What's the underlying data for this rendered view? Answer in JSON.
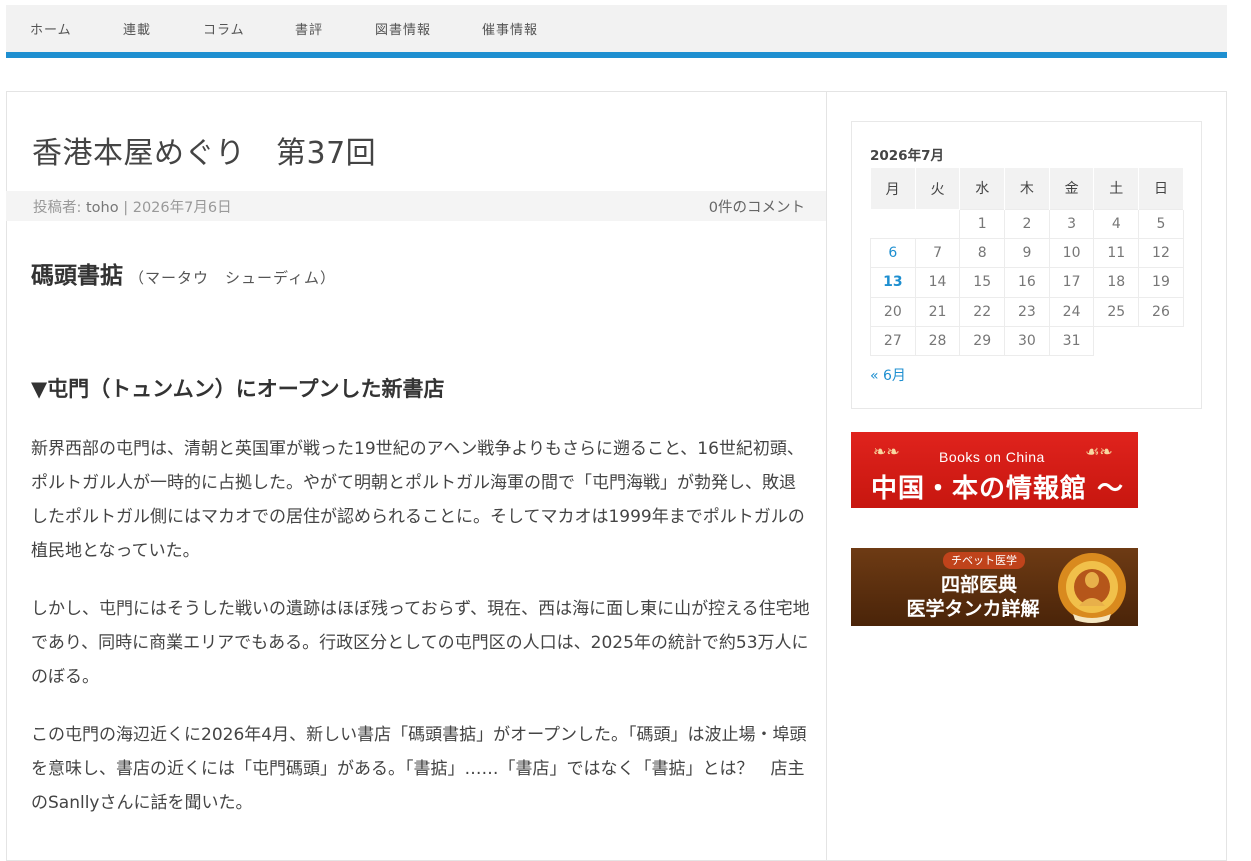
{
  "nav": {
    "items": [
      "ホーム",
      "連載",
      "コラム",
      "書評",
      "図書情報",
      "催事情報"
    ]
  },
  "article": {
    "title": "香港本屋めぐり　第37回",
    "meta": {
      "author_prefix": "投稿者: ",
      "author": "toho",
      "separator": " | ",
      "date": "2026年7月6日",
      "comments": "0件のコメント"
    },
    "store_name": "碼頭書掂",
    "store_reading": "（マータウ　シューディム）",
    "section_heading": "▼屯門（トュンムン）にオープンした新書店",
    "paragraphs": [
      "新界西部の屯門は、清朝と英国軍が戦った19世紀のアヘン戦争よりもさらに遡ること、16世紀初頭、ポルトガル人が一時的に占拠した。やがて明朝とポルトガル海軍の間で「屯門海戦」が勃発し、敗退したポルトガル側にはマカオでの居住が認められることに。そしてマカオは1999年までポルトガルの植民地となっていた。",
      "しかし、屯門にはそうした戦いの遺跡はほぼ残っておらず、現在、西は海に面し東に山が控える住宅地であり、同時に商業エリアでもある。行政区分としての屯門区の人口は、2025年の統計で約53万人にのぼる。",
      "この屯門の海辺近くに2026年4月、新しい書店「碼頭書掂」がオープンした。「碼頭」は波止場・埠頭を意味し、書店の近くには「屯門碼頭」がある。「書掂」……「書店」ではなく「書掂」とは？　店主のSanllyさんに話を聞いた。"
    ]
  },
  "calendar": {
    "caption": "2026年7月",
    "weekdays": [
      "月",
      "火",
      "水",
      "木",
      "金",
      "土",
      "日"
    ],
    "weeks": [
      [
        "",
        "",
        "1",
        "2",
        "3",
        "4",
        "5"
      ],
      [
        "6",
        "7",
        "8",
        "9",
        "10",
        "11",
        "12"
      ],
      [
        "13",
        "14",
        "15",
        "16",
        "17",
        "18",
        "19"
      ],
      [
        "20",
        "21",
        "22",
        "23",
        "24",
        "25",
        "26"
      ],
      [
        "27",
        "28",
        "29",
        "30",
        "31",
        "",
        ""
      ]
    ],
    "linked_days": [
      "6"
    ],
    "today": "13",
    "prev_link": "« 6月"
  },
  "banners": {
    "books_on_china": {
      "subtitle": "Books on China",
      "title": "中国・本の情報館 ～"
    },
    "tibet": {
      "tag": "チベット医学",
      "line1": "四部医典",
      "line2": "医学タンカ詳解"
    }
  },
  "colors": {
    "accent": "#1e8fd0",
    "banner_red": "#d81e18",
    "banner_brown": "#5a2e0f"
  }
}
